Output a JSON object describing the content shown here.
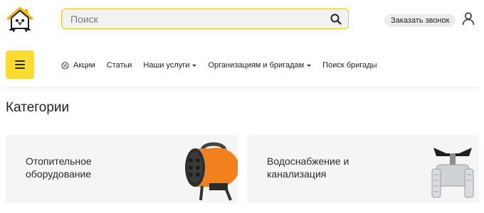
{
  "header": {
    "logo_icon": "house-bird-logo-icon",
    "search": {
      "placeholder": "Поиск",
      "value": "",
      "icon": "search-icon"
    },
    "call_button_label": "Заказать звонок",
    "user_icon": "user-icon"
  },
  "nav": {
    "menu_icon": "hamburger-menu-icon",
    "items": [
      {
        "label": "Акции",
        "icon": "discount-percent-icon",
        "has_dropdown": false
      },
      {
        "label": "Статьи",
        "has_dropdown": false
      },
      {
        "label": "Наши услуги",
        "has_dropdown": true
      },
      {
        "label": "Организациям и бригадам",
        "has_dropdown": true
      },
      {
        "label": "Поиск бригады",
        "has_dropdown": false
      }
    ]
  },
  "categories": {
    "title": "Категории",
    "cards": [
      {
        "line1": "Отопительное",
        "line2": "оборудование",
        "image": "heat-gun-image"
      },
      {
        "line1": "Водоснабжение и",
        "line2": "канализация",
        "image": "ball-valve-image"
      }
    ]
  },
  "colors": {
    "accent": "#fddb2f",
    "search_border": "#f1c21b",
    "card_bg": "#f5f5f5",
    "heater_orange": "#f2811d"
  }
}
